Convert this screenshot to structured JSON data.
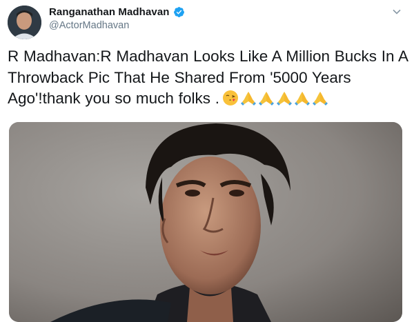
{
  "tweet": {
    "display_name": "Ranganathan Madhavan",
    "handle": "@ActorMadhavan",
    "text": "R Madhavan:R Madhavan Looks Like A Million Bucks In A Throwback Pic That He Shared From '5000 Years Ago'!thank you so much folks .",
    "emojis": [
      "face-blowing-kiss",
      "folded-hands",
      "folded-hands",
      "folded-hands",
      "folded-hands",
      "folded-hands"
    ],
    "verified": true
  },
  "colors": {
    "name": "#14171a",
    "handle": "#657786",
    "verified": "#1da1f2"
  }
}
